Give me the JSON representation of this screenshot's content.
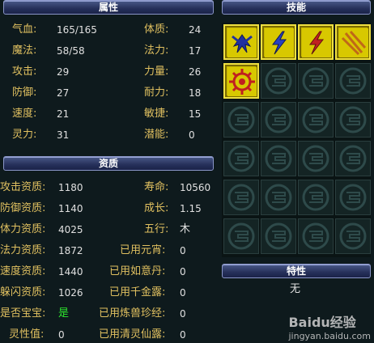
{
  "panels": {
    "attributes_title": "属性",
    "skills_title": "技能",
    "aptitude_title": "资质",
    "traits_title": "特性",
    "traits_value": "无"
  },
  "attributes_left": [
    {
      "label": "气血:",
      "value": "165/165"
    },
    {
      "label": "魔法:",
      "value": "58/58"
    },
    {
      "label": "攻击:",
      "value": "29"
    },
    {
      "label": "防御:",
      "value": "27"
    },
    {
      "label": "速度:",
      "value": "21"
    },
    {
      "label": "灵力:",
      "value": "31"
    }
  ],
  "attributes_right": [
    {
      "label": "体质:",
      "value": "24"
    },
    {
      "label": "法力:",
      "value": "17"
    },
    {
      "label": "力量:",
      "value": "26"
    },
    {
      "label": "耐力:",
      "value": "18"
    },
    {
      "label": "敏捷:",
      "value": "15"
    },
    {
      "label": "潜能:",
      "value": "0"
    }
  ],
  "aptitude_left": [
    {
      "label": "攻击资质:",
      "value": "1180"
    },
    {
      "label": "防御资质:",
      "value": "1140"
    },
    {
      "label": "体力资质:",
      "value": "4025"
    },
    {
      "label": "法力资质:",
      "value": "1872"
    },
    {
      "label": "速度资质:",
      "value": "1440"
    },
    {
      "label": "躲闪资质:",
      "value": "1026"
    },
    {
      "label": "是否宝宝:",
      "value": "是"
    },
    {
      "label": "灵性值:",
      "value": "0"
    }
  ],
  "aptitude_right": [
    {
      "label": "寿命:",
      "value": "10560"
    },
    {
      "label": "成长:",
      "value": "1.15"
    },
    {
      "label": "五行:",
      "value": "木"
    },
    {
      "label": "已用元宵:",
      "value": "0"
    },
    {
      "label": "已用如意丹:",
      "value": "0"
    },
    {
      "label": "已用千金露:",
      "value": "0"
    },
    {
      "label": "已用炼兽珍经:",
      "value": "0"
    },
    {
      "label": "已用清灵仙露:",
      "value": "0"
    }
  ],
  "skills": [
    {
      "name": "blue-bird-skill-icon"
    },
    {
      "name": "lightning-skill-icon"
    },
    {
      "name": "red-lightning-skill-icon"
    },
    {
      "name": "claw-skill-icon"
    },
    {
      "name": "sun-wheel-skill-icon"
    }
  ],
  "watermark": {
    "brand": "Baidu经验",
    "url": "jingyan.baidu.com"
  },
  "colors": {
    "label": "#e0c060",
    "value": "#e0e0e0",
    "yes_value": "#2ee62e",
    "panel_bar": "#26305a"
  }
}
